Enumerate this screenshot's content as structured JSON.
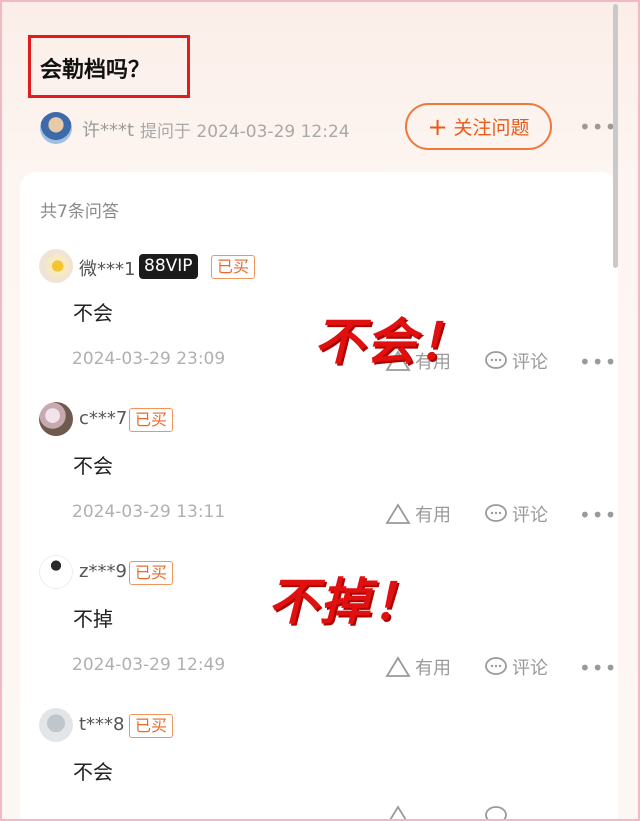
{
  "question": {
    "title": "会勒档吗？"
  },
  "asker": {
    "name": "许***t",
    "asked_time": "提问于 2024-03-29 12:24"
  },
  "follow_button": {
    "label": "关注问题"
  },
  "answers_header": {
    "count_label": "共7条问答"
  },
  "actions": {
    "useful_label": "有用",
    "comment_label": "评论"
  },
  "answers": [
    {
      "username": "微***1",
      "vip": "88VIP",
      "bought": "已买",
      "text": "不会",
      "time": "2024-03-29 23:09"
    },
    {
      "username": "c***7",
      "bought": "已买",
      "text": "不会",
      "time": "2024-03-29 13:11"
    },
    {
      "username": "z***9",
      "bought": "已买",
      "text": "不掉",
      "time": "2024-03-29 12:49"
    },
    {
      "username": "t***8",
      "bought": "已买",
      "text": "不会",
      "time": ""
    }
  ],
  "overlays": {
    "first": "不会！",
    "second": "不掉！"
  },
  "colors": {
    "accent": "#e85a1a",
    "highlight_border": "#e01c1c",
    "overlay_red": "#e01010"
  }
}
